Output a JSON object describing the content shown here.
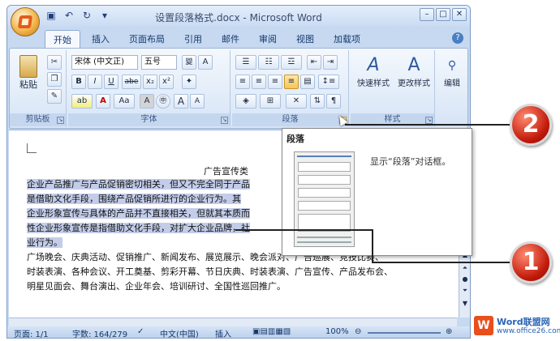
{
  "window": {
    "title": "设置段落格式.docx - Microsoft Word",
    "controls": [
      "–",
      "□",
      "✕"
    ]
  },
  "qat": [
    "save-icon",
    "undo-icon",
    "redo-icon",
    "customize-icon"
  ],
  "tabs": [
    "开始",
    "插入",
    "页面布局",
    "引用",
    "邮件",
    "审阅",
    "视图",
    "加载项"
  ],
  "ribbon": {
    "clipboard": {
      "label": "剪贴板",
      "paste": "粘贴"
    },
    "font": {
      "label": "字体",
      "font_name": "宋体 (中文正)",
      "font_size": "五号",
      "bold": "B",
      "italic": "I",
      "underline": "U",
      "strike": "abe",
      "sub": "x₂",
      "sup": "x²",
      "change_case": "Aa",
      "grow": "A",
      "shrink": "A",
      "char_border": "A",
      "char_shading": "A"
    },
    "paragraph": {
      "label": "段落"
    },
    "styles": {
      "label": "样式",
      "quick_styles": "快速样式",
      "change_styles": "更改样式"
    },
    "editing": {
      "label": "编辑"
    }
  },
  "document": {
    "title": "广告宣传类",
    "selected_lines": [
      "企业产品推广与产品促销密切相关，但又不完全同于产品",
      "是借助文化手段，围绕产品促销所进行的企业行为。其",
      "企业形象宣传与具体的产品并不直接相关，但就其本质而",
      "性企业形象宣传是指借助文化手段，对扩大企业品牌，社",
      "业行为。"
    ],
    "normal_lines": [
      "广场晚会、庆典活动、促销推广、新闻发布、展览展示、晚会派对、广告巡展、竞技比赛、",
      "时装表演、各种会议、开工奠基、剪彩开幕、节日庆典、时装表演、广告宣传、产品发布会、",
      "明星见面会、舞台演出、企业年会、培训研讨、全国性巡回推广。"
    ]
  },
  "popup": {
    "title": "段落",
    "description": "显示“段落”对话框。"
  },
  "callouts": [
    "2",
    "1"
  ],
  "statusbar": {
    "page": "页面: 1/1",
    "words": "字数: 164/279",
    "language": "中文(中国)",
    "mode": "插入",
    "zoom": "100%"
  },
  "watermark": {
    "logo": "W",
    "line1": "Word联盟网",
    "line2": "www.office26.com"
  }
}
